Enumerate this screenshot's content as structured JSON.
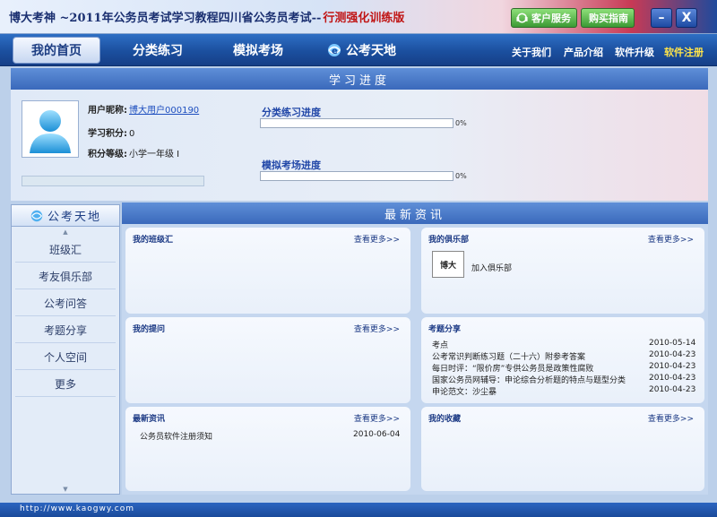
{
  "window": {
    "title_main": "博大考神 ~2011年公务员考试学习教程四川省公务员考试--",
    "title_sub": "行测强化训练版",
    "btn_service": "客户服务",
    "btn_buy": "购买指南",
    "btn_min": "–",
    "btn_close": "X"
  },
  "nav": {
    "tabs": [
      "我的首页",
      "分类练习",
      "模拟考场",
      "公考天地"
    ],
    "links": [
      "关于我们",
      "产品介绍",
      "软件升级",
      "软件注册"
    ]
  },
  "progress": {
    "header": "学习进度",
    "nickname_label": "用户昵称:",
    "nickname_value": "博大用户000190",
    "points_label": "学习积分:",
    "points_value": "0",
    "level_label": "积分等级:",
    "level_value": "小学一年级 I",
    "category_label": "分类练习进度",
    "category_pct_text": "0%",
    "category_pct": 0,
    "exam_label": "模拟考场进度",
    "exam_pct_text": "0%",
    "exam_pct": 0
  },
  "sidebar": {
    "header": "公考天地",
    "items": [
      "班级汇",
      "考友俱乐部",
      "公考问答",
      "考题分享",
      "个人空间",
      "更多"
    ]
  },
  "news": {
    "header": "最新资讯",
    "more_label": "查看更多>>",
    "class_title": "我的班级汇",
    "club_title": "我的俱乐部",
    "club_logo_text": "博大",
    "club_join": "加入俱乐部",
    "questions_title": "我的提问",
    "share_title": "考题分享",
    "share_items": [
      {
        "title": "考点",
        "date": "2010-05-14"
      },
      {
        "title": "公考常识判断练习题（二十六）附参考答案",
        "date": "2010-04-23"
      },
      {
        "title": "每日时评：“限价房”专供公务员是政策性腐败",
        "date": "2010-04-23"
      },
      {
        "title": "国家公务员网辅导：申论综合分析题的特点与题型分类",
        "date": "2010-04-23"
      },
      {
        "title": "申论范文：沙尘暴",
        "date": "2010-04-23"
      }
    ],
    "latest_title": "最新资讯",
    "latest_items": [
      {
        "title": "公务员软件注册须知",
        "date": "2010-06-04"
      }
    ],
    "favorites_title": "我的收藏"
  },
  "status": {
    "url": "http://www.kaogwy.com"
  },
  "colors": {
    "accent_blue": "#3a69bb",
    "nav_blue": "#1b4f9f",
    "title_red": "#c01515",
    "link_yellow": "#ffe44a",
    "green_button": "#3c9a34"
  }
}
